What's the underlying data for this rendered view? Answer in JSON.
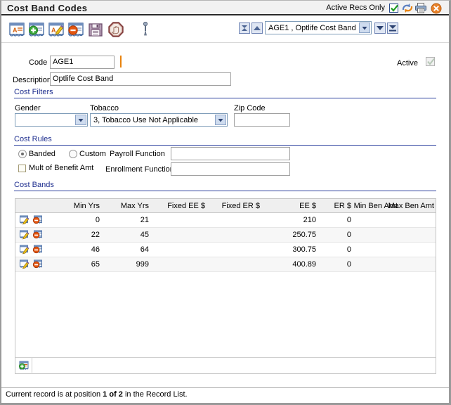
{
  "window": {
    "title": "Cost Band Codes",
    "active_recs_label": "Active Recs Only",
    "active_recs_checked": true,
    "icons": {
      "refresh": "refresh-icon",
      "print": "print-icon",
      "close": "close-icon"
    }
  },
  "toolbar": {
    "buttons": [
      {
        "name": "find-record-button",
        "title": "Find Record"
      },
      {
        "name": "add-record-button",
        "title": "Add Record"
      },
      {
        "name": "edit-record-button",
        "title": "Edit Record"
      },
      {
        "name": "delete-record-button",
        "title": "Delete Record"
      },
      {
        "name": "save-button",
        "title": "Save"
      },
      {
        "name": "stop-button",
        "title": "Cancel"
      },
      {
        "name": "attachment-button",
        "title": "Attachment"
      }
    ],
    "record_nav": {
      "first_label": "first-record-icon",
      "prev_label": "previous-record-icon",
      "next_label": "next-record-icon",
      "last_label": "last-record-icon",
      "selected_record": "AGE1 , Optlife Cost Band"
    }
  },
  "form": {
    "code_label": "Code",
    "code_value": "AGE1",
    "active_label": "Active",
    "active_checked": true,
    "description_label": "Description",
    "description_value": "Optlife Cost Band"
  },
  "cost_filters": {
    "section_title": "Cost Filters",
    "gender_label": "Gender",
    "gender_value": "",
    "tobacco_label": "Tobacco",
    "tobacco_value": "3, Tobacco Use Not Applicable",
    "zip_label": "Zip Code",
    "zip_value": ""
  },
  "cost_rules": {
    "section_title": "Cost Rules",
    "banded_label": "Banded",
    "banded_selected": true,
    "custom_label": "Custom",
    "custom_selected": false,
    "mult_label": "Mult of Benefit Amt",
    "mult_checked": false,
    "payroll_function_label": "Payroll Function",
    "payroll_function_value": "",
    "enrollment_function_label": "Enrollment Function",
    "enrollment_function_value": ""
  },
  "cost_bands": {
    "section_title": "Cost Bands",
    "columns": [
      "Min Yrs",
      "Max Yrs",
      "Fixed EE $",
      "Fixed ER $",
      "EE $",
      "ER $",
      "Min Ben Amt",
      "Max Ben Amt"
    ],
    "rows": [
      {
        "min_yrs": "0",
        "max_yrs": "21",
        "fixed_ee": "",
        "fixed_er": "",
        "ee": "210",
        "er": "0",
        "min_ben": "",
        "max_ben": ""
      },
      {
        "min_yrs": "22",
        "max_yrs": "45",
        "fixed_ee": "",
        "fixed_er": "",
        "ee": "250.75",
        "er": "0",
        "min_ben": "",
        "max_ben": ""
      },
      {
        "min_yrs": "46",
        "max_yrs": "64",
        "fixed_ee": "",
        "fixed_er": "",
        "ee": "300.75",
        "er": "0",
        "min_ben": "",
        "max_ben": ""
      },
      {
        "min_yrs": "65",
        "max_yrs": "999",
        "fixed_ee": "",
        "fixed_er": "",
        "ee": "400.89",
        "er": "0",
        "min_ben": "",
        "max_ben": ""
      }
    ],
    "add_button_name": "add-cost-band-icon"
  },
  "statusbar": {
    "text_before": "Current record is at position ",
    "position": "1 of 2",
    "text_after": " in the Record List."
  },
  "colors": {
    "section_heading": "#1f2f8f",
    "section_rule": "#2c3f9e",
    "title_bar_bg": "#f2f2f2",
    "checkbox_check": "#1f9c1f",
    "required_marker": "#e8820c"
  }
}
